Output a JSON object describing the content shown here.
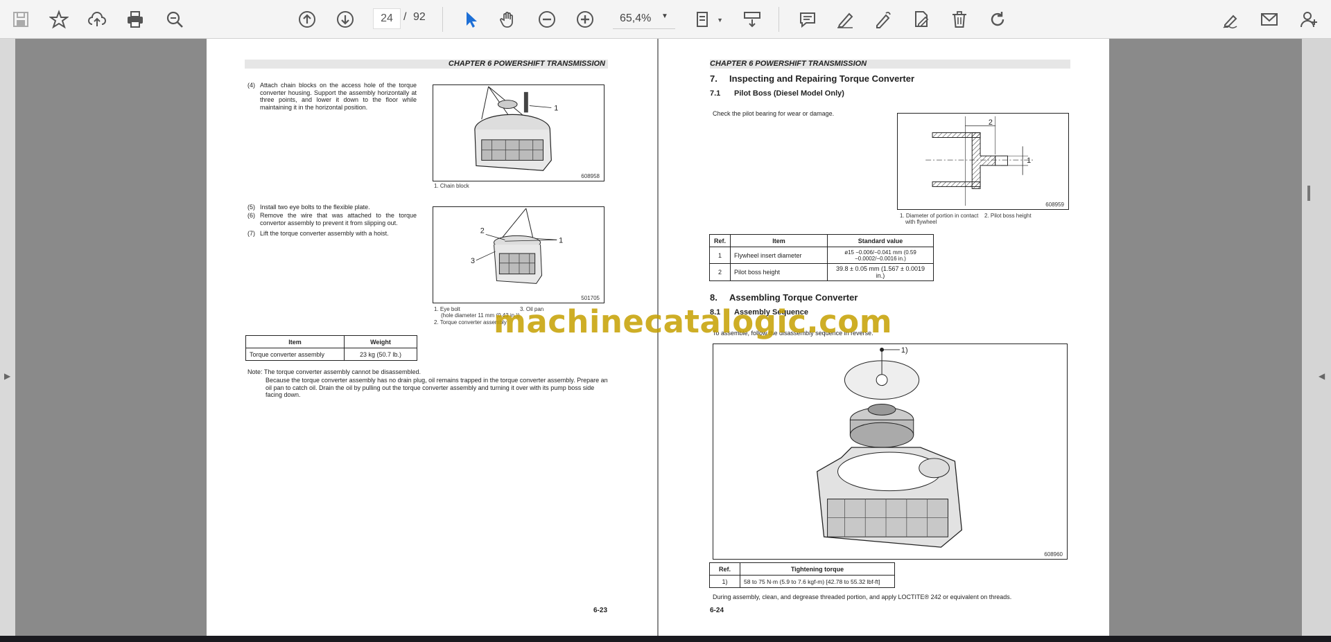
{
  "toolbar": {
    "items": [
      "save",
      "bookmark",
      "upload",
      "print",
      "zoom-search"
    ],
    "current_page": "24",
    "page_separator": "/",
    "total_pages": "92",
    "zoom": "65,4%"
  },
  "left_page": {
    "chapter": "CHAPTER 6 POWERSHIFT TRANSMISSION",
    "step4_num": "(4)",
    "step4_text": "Attach chain blocks on the access hole of the torque converter housing. Support the assembly horizontally at three points, and lower it down to the floor while maintaining it in the horizontal position.",
    "fig1_callout": "1",
    "fig1_id": "608958",
    "fig1_caption": "1.  Chain block",
    "step5_num": "(5)",
    "step5_text": "Install two eye bolts to the flexible plate.",
    "step6_num": "(6)",
    "step6_text": "Remove the wire that was attached to the torque convertor assembly to prevent it from slipping out.",
    "step7_num": "(7)",
    "step7_text": "Lift the torque converter assembly with a hoist.",
    "fig2_callouts": [
      "1",
      "2",
      "3"
    ],
    "fig2_id": "501705",
    "fig2_caption_1": "1.  Eye bolt",
    "fig2_caption_1b": "(hole diameter 11 mm (0.43 in.))",
    "fig2_caption_2": "2.  Torque converter assembly",
    "fig2_caption_3": "3.  Oil pan",
    "weight_table": {
      "headers": [
        "Item",
        "Weight"
      ],
      "rows": [
        [
          "Torque converter assembly",
          "23 kg (50.7 lb.)"
        ]
      ]
    },
    "note_1": "Note: The torque converter assembly cannot be disassembled.",
    "note_2": "Because the torque converter assembly has no drain plug, oil remains trapped in the torque converter assembly. Prepare an oil pan to catch oil. Drain the oil by pulling out the torque converter assembly and turning it over with its pump boss side facing down.",
    "page_number": "6-23"
  },
  "right_page": {
    "chapter": "CHAPTER 6 POWERSHIFT TRANSMISSION",
    "h7_num": "7.",
    "h7": "Inspecting and Repairing Torque Converter",
    "h71_num": "7.1",
    "h71": "Pilot Boss (Diesel Model Only)",
    "check_text": "Check the pilot bearing for wear or damage.",
    "fig3_callouts": [
      "2",
      "1"
    ],
    "fig3_id": "608959",
    "fig3_caption_1": "1.  Diameter of portion in contact",
    "fig3_caption_1b": "with flywheel",
    "fig3_caption_2": "2.  Pilot boss height",
    "std_table": {
      "headers": [
        "Ref.",
        "Item",
        "Standard value"
      ],
      "rows": [
        [
          "1",
          "Flywheel insert diameter",
          "ø15 −0.006/−0.041 mm (0.59 −0.0002/−0.0016 in.)"
        ],
        [
          "2",
          "Pilot boss height",
          "39.8 ± 0.05 mm (1.567 ± 0.0019 in.)"
        ]
      ]
    },
    "h8_num": "8.",
    "h8": "Assembling Torque Converter",
    "h81_num": "8.1",
    "h81": "Assembly Sequence",
    "assembly_text": "To assemble, follow the disassembly sequence in reverse.",
    "fig4_callout": "1)",
    "fig4_id": "608960",
    "torque_table": {
      "headers": [
        "Ref.",
        "Tightening torque"
      ],
      "rows": [
        [
          "1)",
          "58 to 75 N·m (5.9 to 7.6 kgf-m) [42.78 to 55.32 lbf-ft]"
        ]
      ]
    },
    "final_text": "During assembly, clean,  and degrease threaded portion, and apply LOCTITE® 242 or equivalent on threads.",
    "page_number": "6-24"
  },
  "watermark": "machinecatalogic.com"
}
